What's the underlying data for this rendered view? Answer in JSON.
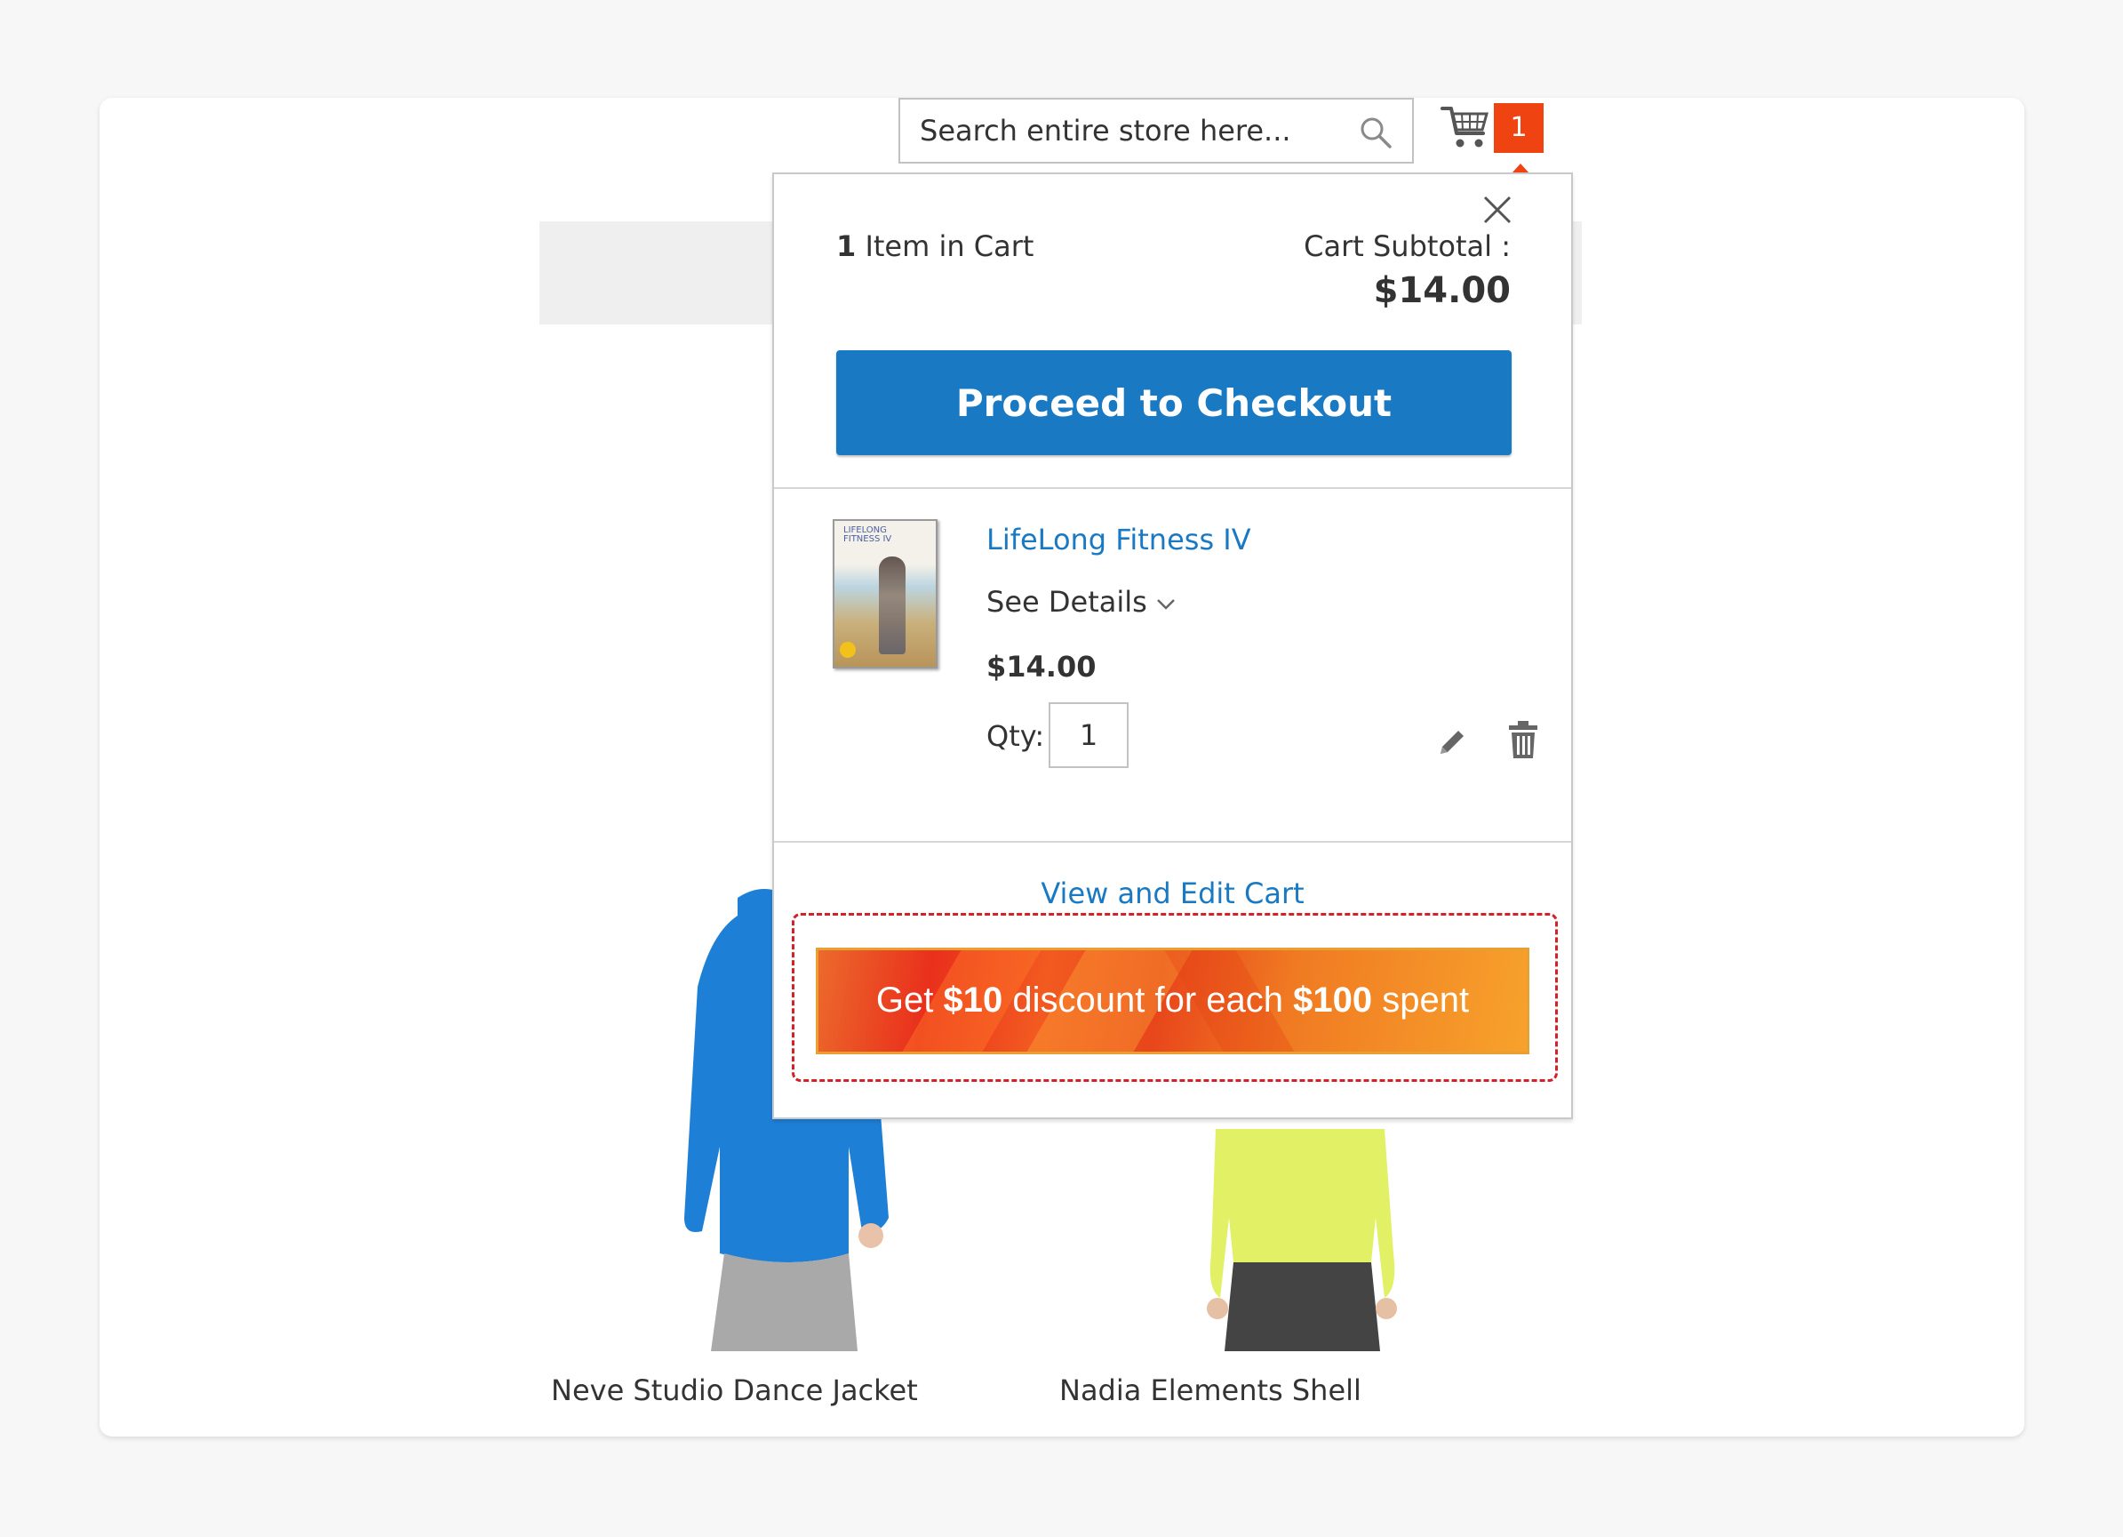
{
  "header": {
    "search_placeholder": "Search entire store here...",
    "cart_count": "1"
  },
  "minicart": {
    "items_count": "1",
    "items_label": " Item in Cart",
    "subtotal_label": "Cart Subtotal :",
    "subtotal_value": "$14.00",
    "checkout_label": "Proceed to Checkout",
    "item": {
      "name": "LifeLong Fitness IV",
      "thumb_text": "LIFELONG FITNESS IV",
      "see_details": "See Details",
      "price": "$14.00",
      "qty_label": "Qty:",
      "qty_value": "1"
    },
    "view_edit_label": "View and Edit Cart",
    "promo": {
      "prefix": "Get ",
      "amount1": "$10",
      "middle": " discount for each ",
      "amount2": "$100",
      "suffix": " spent"
    }
  },
  "products": [
    {
      "name": "Neve Studio Dance Jacket"
    },
    {
      "name": "Nadia Elements Shell"
    }
  ],
  "colors": {
    "accent_blue": "#1979c3",
    "badge_orange": "#ef4411",
    "promo_outline_red": "#d32029"
  }
}
